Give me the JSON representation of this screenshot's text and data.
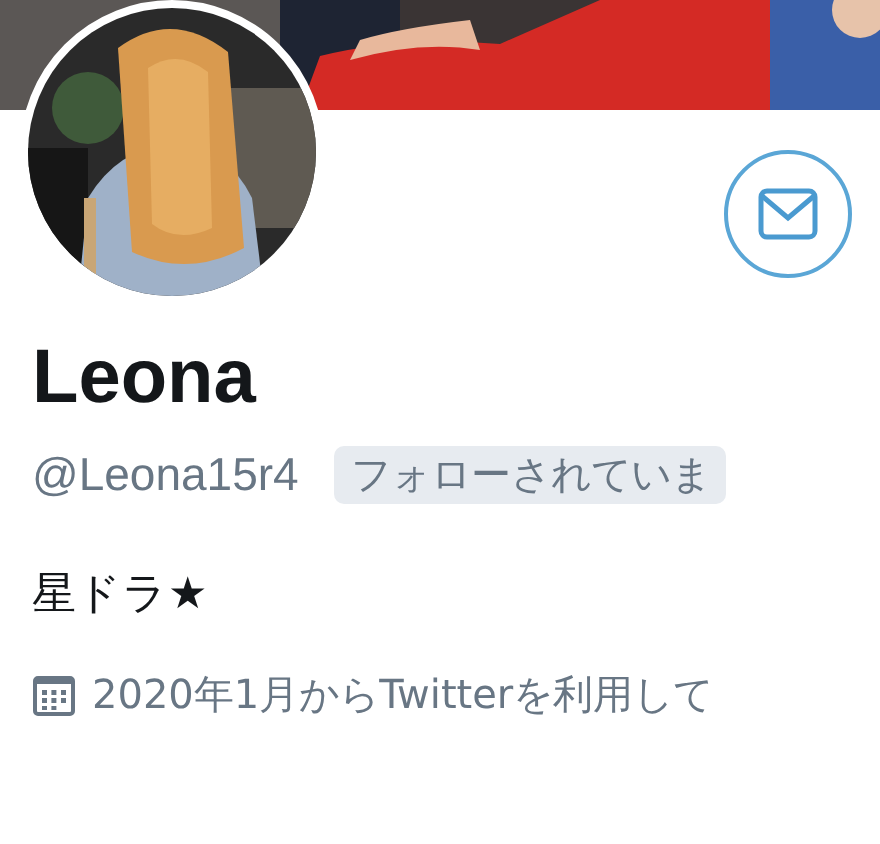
{
  "profile": {
    "name": "Leona",
    "handle": "@Leona15r4",
    "follows_you_badge": "フォローされていま",
    "bio": "星ドラ★",
    "joined": "2020年1月からTwitterを利用して"
  }
}
